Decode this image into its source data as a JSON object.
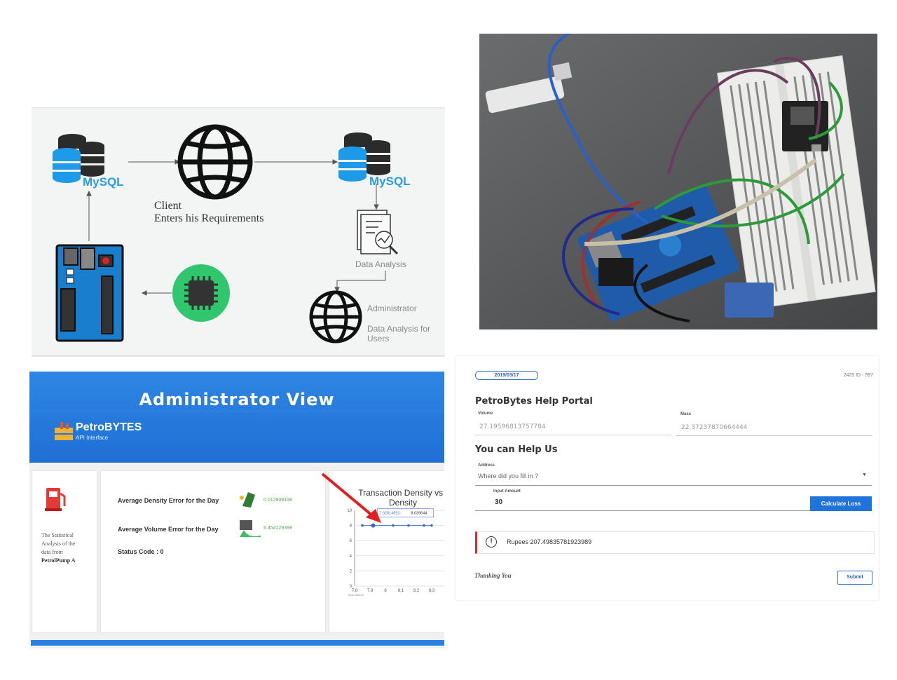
{
  "diagram": {
    "mysql_label_left": "MySQL",
    "mysql_label_right": "MySQL",
    "client_line1": "Client",
    "client_line2": "Enters his Requirements",
    "data_analysis": "Data Analysis",
    "administrator": "Administrator",
    "analysis_users_line1": "Data Analysis for",
    "analysis_users_line2": "Users"
  },
  "admin": {
    "title": "Administrator View",
    "brand_name": "PetroBYTES",
    "brand_sub": "API Interface",
    "stat_text_line1": "The Statistical",
    "stat_text_line2": "Analysis of the",
    "stat_text_line3": "data from",
    "stat_text_line4": "PetrolPump A",
    "density_error_label": "Average Density Error for the Day",
    "density_error_value": "0.012809158",
    "volume_error_label": "Average Volume Error for the Day",
    "volume_error_value": "5.454129399",
    "status_code": "Status Code : 0",
    "chart_title_line1": "Transaction Density vs I",
    "chart_title_line2": "Density",
    "colors": {
      "header": "#2f86e4",
      "accent": "#1f6fd4",
      "arrow": "#e02020"
    }
  },
  "chart_data": {
    "type": "line",
    "title": "Transaction Density vs I Density",
    "xlabel": "Total Volume",
    "ylabel": "",
    "ylim": [
      0,
      10
    ],
    "y_ticks": [
      "0",
      "2",
      "4",
      "6",
      "8",
      "10"
    ],
    "x_ticks": [
      "7.8",
      "7.9",
      "8",
      "8.1",
      "8.2",
      "8.3"
    ],
    "x": [
      7.85,
      7.92,
      8.05,
      8.15,
      8.25,
      8.3
    ],
    "values": [
      8,
      8,
      8,
      8,
      8,
      8
    ],
    "tooltip_x": "7.92814952",
    "tooltip_y": "8.039644"
  },
  "portal": {
    "date": "2019/03/17",
    "header_id": "2425 ID - 597",
    "title": "PetroBytes Help Portal",
    "volume_label": "Volume",
    "volume_value": "27.19596813757784",
    "mass_label": "Mass",
    "mass_value": "22.37237870664444",
    "help_title": "You can Help Us",
    "address_label": "Address",
    "address_placeholder": "Where did you fill in ?",
    "amount_label": "Input Amount",
    "amount_value": "30",
    "calculate_label": "Calculate Loss",
    "result_text": "Rupees 207.49835781923989",
    "thanks": "Thanking You",
    "submit_label": "Submit",
    "colors": {
      "primary": "#1f73d9",
      "error": "#d32f2f"
    }
  }
}
